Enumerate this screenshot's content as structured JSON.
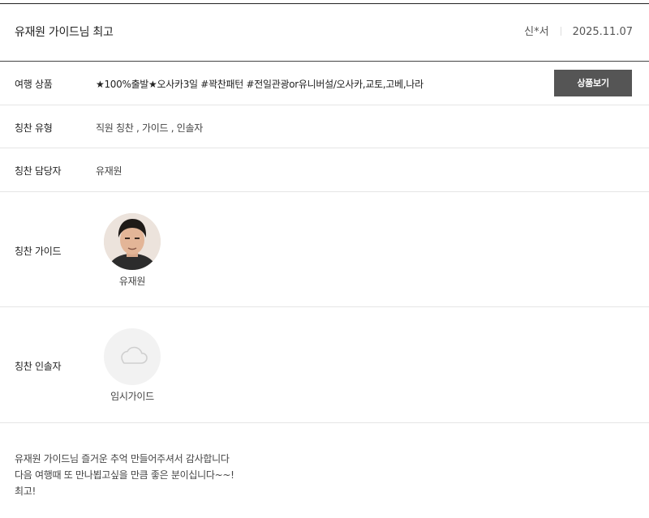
{
  "review": {
    "title": "유재원 가이드님 최고",
    "author": "신*서",
    "date": "2025.11.07"
  },
  "details": {
    "product_label": "여행 상품",
    "product_value": "★100%출발★오사카3일 #꽉찬패턴 #전일관광or유니버설/오사카,교토,고베,나라",
    "product_button": "상품보기",
    "praise_type_label": "칭찬 유형",
    "praise_type_value": "직원 칭찬 , 가이드 , 인솔자",
    "staff_label": "칭찬 담당자",
    "staff_value": "유재원",
    "guide_label": "칭찬 가이드",
    "guide_name": "유재원",
    "escort_label": "칭찬 인솔자",
    "escort_name": "임시가이드"
  },
  "message": {
    "lines": [
      "유재원 가이드님 즐거운 추억 만들어주셔서 감사합니다",
      "다음 여행때 또 만나뵙고싶을 만큼 좋은 분이십니다~~!",
      "최고!"
    ]
  },
  "icons": {
    "escort_placeholder": "cloud-icon"
  }
}
